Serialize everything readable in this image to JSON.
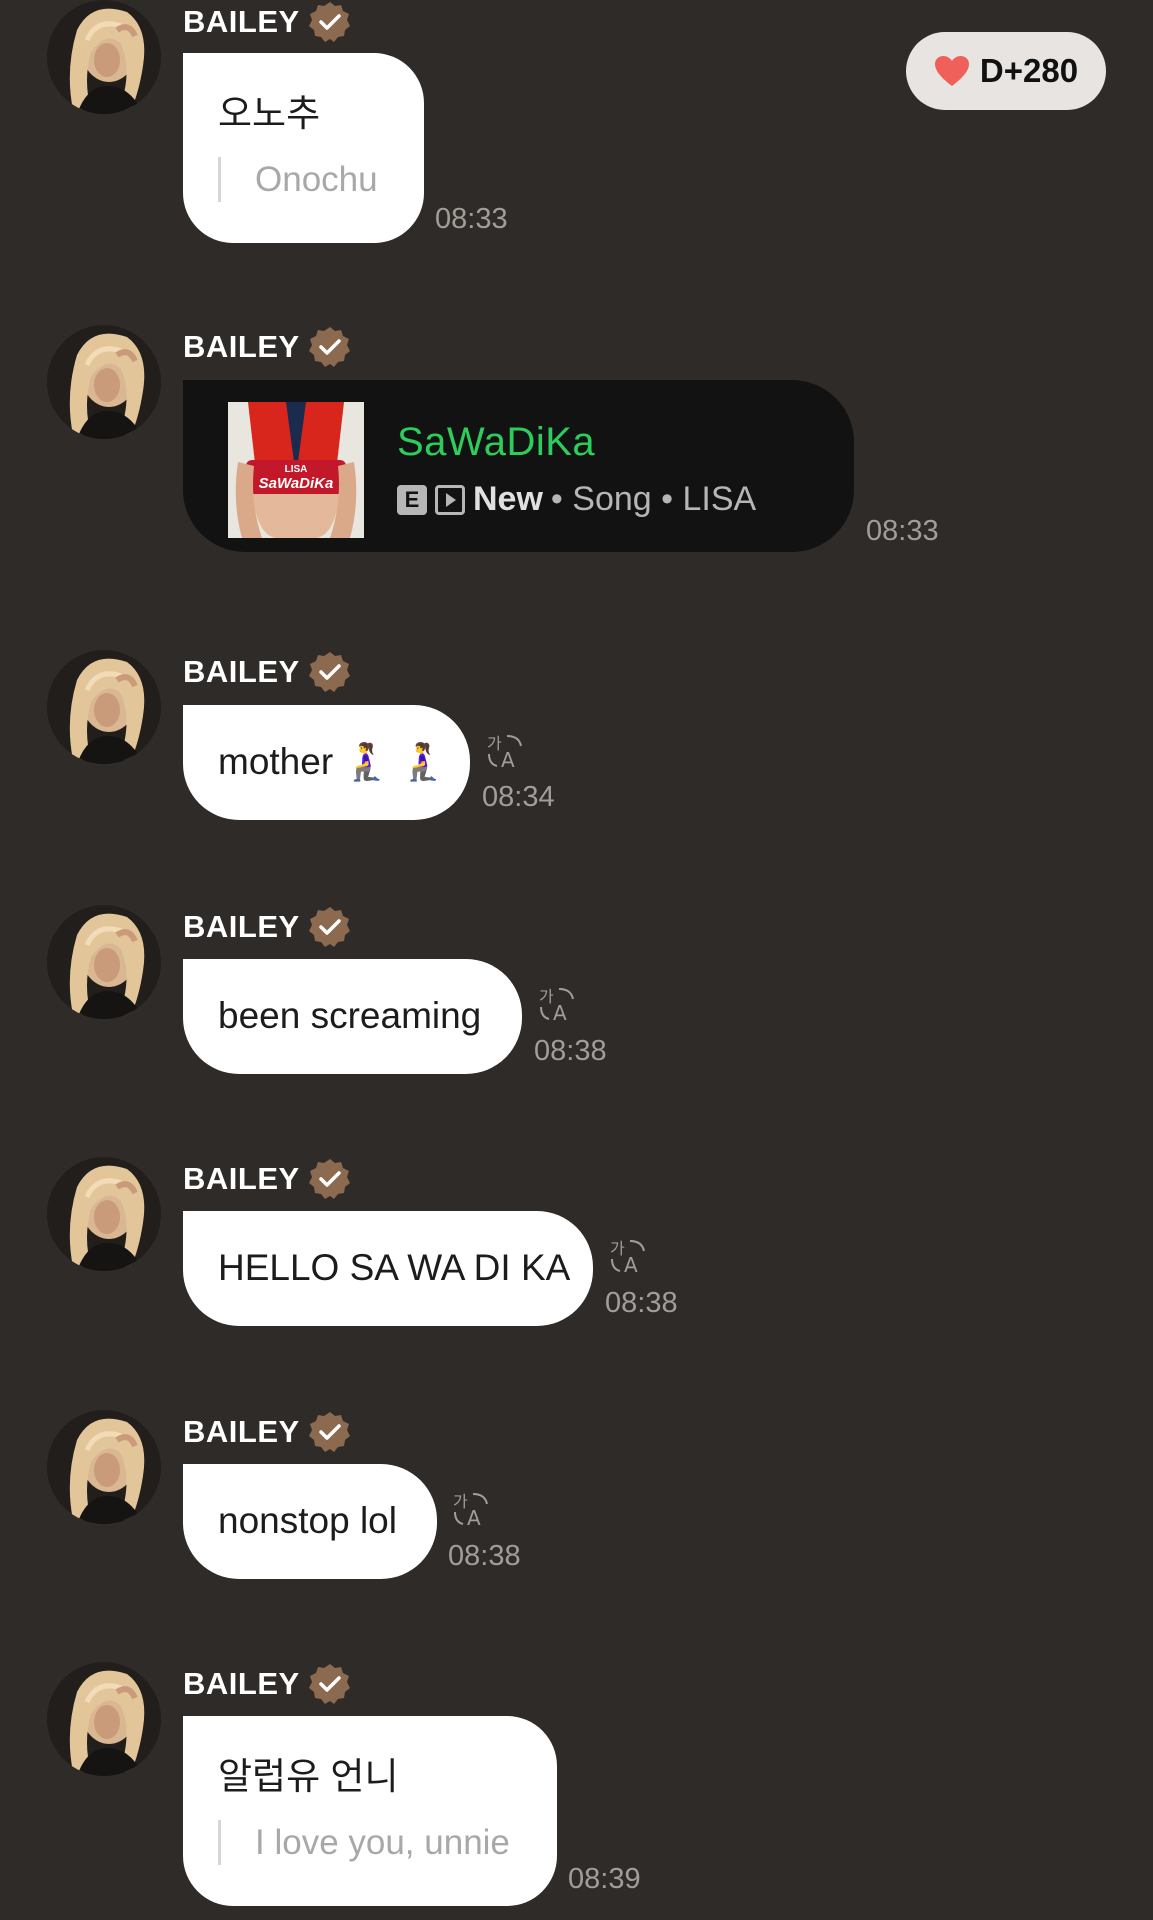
{
  "header": {
    "day_counter": "D+280",
    "heart_color": "#f0605a"
  },
  "colors": {
    "background": "#2e2b28",
    "bubble": "#ffffff",
    "verified_badge": "#8b6a4f",
    "song_title": "#2ccd5b"
  },
  "messages": [
    {
      "sender": "BAILEY",
      "text": "오노추",
      "translation": "Onochu",
      "time": "08:33"
    },
    {
      "sender": "BAILEY",
      "music": {
        "title": "SaWaDiKa",
        "explicit": "E",
        "new_label": "New",
        "meta": "• Song • LISA",
        "cover_text_top": "LISA",
        "cover_text_main": "SaWaDiKa"
      },
      "time": "08:33"
    },
    {
      "sender": "BAILEY",
      "text": "mother 🧎‍♀️ 🧎‍♀️",
      "time": "08:34"
    },
    {
      "sender": "BAILEY",
      "text": "been screaming",
      "time": "08:38"
    },
    {
      "sender": "BAILEY",
      "text": "HELLO SA WA DI KA",
      "time": "08:38"
    },
    {
      "sender": "BAILEY",
      "text": "nonstop lol",
      "time": "08:38"
    },
    {
      "sender": "BAILEY",
      "text": "알럽유 언니",
      "translation": "I love you, unnie",
      "time": "08:39"
    }
  ]
}
